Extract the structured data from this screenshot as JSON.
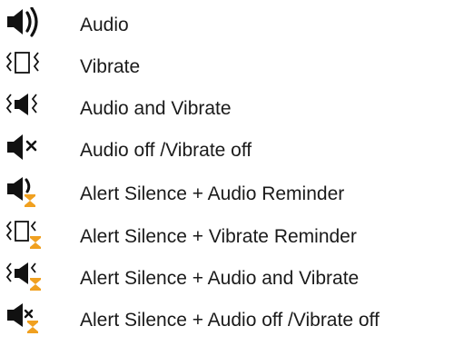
{
  "legend": {
    "items": [
      {
        "icon": "audio-icon",
        "label": "Audio"
      },
      {
        "icon": "vibrate-icon",
        "label": "Vibrate"
      },
      {
        "icon": "audio-and-vibrate-icon",
        "label": "Audio and Vibrate"
      },
      {
        "icon": "audio-off-vibrate-off-icon",
        "label": "Audio off /Vibrate off"
      },
      {
        "icon": "alert-silence-audio-reminder-icon",
        "label": "Alert Silence + Audio Reminder"
      },
      {
        "icon": "alert-silence-vibrate-reminder-icon",
        "label": "Alert Silence + Vibrate Reminder"
      },
      {
        "icon": "alert-silence-audio-and-vibrate-icon",
        "label": "Alert Silence + Audio and Vibrate"
      },
      {
        "icon": "alert-silence-audio-off-vibrate-off-icon",
        "label": "Alert Silence + Audio off /Vibrate off"
      }
    ]
  },
  "colors": {
    "icon": "#111111",
    "hourglass": "#f0a020",
    "text": "#1a1a1a"
  }
}
